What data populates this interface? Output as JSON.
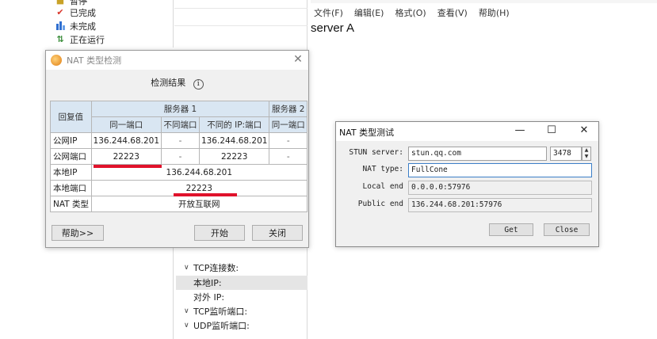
{
  "task_list": {
    "items": [
      {
        "icon": "paused-icon",
        "label": "暂停"
      },
      {
        "icon": "check-icon",
        "label": "已完成"
      },
      {
        "icon": "bar-chart-icon",
        "label": "未完成"
      },
      {
        "icon": "running-icon",
        "label": "正在运行"
      }
    ],
    "colors": {
      "check": "#d9362b",
      "bar": "#2f6fd0",
      "run": "#3a8d3a"
    }
  },
  "tcp_panel": {
    "items": [
      {
        "label": "TCP连接数:",
        "expandable": true
      },
      {
        "label": "本地IP:",
        "selected": true
      },
      {
        "label": "对外 IP:"
      },
      {
        "label": "TCP监听端口:",
        "expandable": true
      },
      {
        "label": "UDP监听端口:",
        "expandable": true
      }
    ]
  },
  "notepad": {
    "menu": [
      "文件(F)",
      "编辑(E)",
      "格式(O)",
      "查看(V)",
      "帮助(H)"
    ],
    "content": "server A"
  },
  "nat_dialog_1": {
    "title": "NAT 类型检测",
    "section_title": "检测结果",
    "table": {
      "col_reply": "回复值",
      "col_server1": "服务器 1",
      "col_server2": "服务器 2",
      "sub_same_port": "同一端口",
      "sub_diff_port": "不同端口",
      "sub_diff_ip_port": "不同的 IP:端口",
      "sub_s2_same_port": "同一端口",
      "rows": {
        "public_ip": {
          "label": "公网IP",
          "same": "136.244.68.201",
          "diff_port": "-",
          "diff_ip": "136.244.68.201",
          "s2": "-"
        },
        "public_port": {
          "label": "公网端口",
          "same": "22223",
          "diff_port": "-",
          "diff_ip": "22223",
          "s2": "-"
        },
        "local_ip": {
          "label": "本地IP",
          "value": "136.244.68.201"
        },
        "local_port": {
          "label": "本地端口",
          "value": "22223"
        },
        "nat_type": {
          "label": "NAT 类型",
          "value": "开放互联网"
        }
      }
    },
    "buttons": {
      "help": "帮助>>",
      "start": "开始",
      "close": "关闭"
    },
    "highlight_color": "#e0122b"
  },
  "nat_dialog_2": {
    "title": "NAT 类型测试",
    "window_buttons": {
      "minimize": "—",
      "maximize": "☐",
      "close": "✕"
    },
    "fields": {
      "stun_server_label": "STUN server:",
      "stun_server_value": "stun.qq.com",
      "stun_port_value": "3478",
      "nat_type_label": "NAT type:",
      "nat_type_value": "FullCone",
      "local_end_label": "Local end",
      "local_end_value": "0.0.0.0:57976",
      "public_end_label": "Public end",
      "public_end_value": "136.244.68.201:57976"
    },
    "buttons": {
      "get": "Get",
      "close": "Close"
    }
  }
}
